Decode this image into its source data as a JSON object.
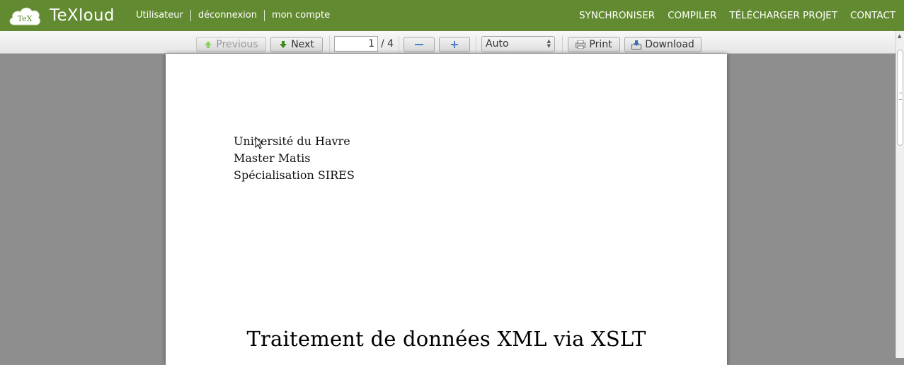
{
  "app": {
    "brand": "TeXloud",
    "logo_text": "TeX"
  },
  "nav": {
    "left": [
      "Utilisateur",
      "déconnexion",
      "mon compte"
    ],
    "right": [
      "SYNCHRONISER",
      "COMPILER",
      "TÉLÉCHARGER PROJET",
      "CONTACT"
    ]
  },
  "toolbar": {
    "previous_label": "Previous",
    "next_label": "Next",
    "page_value": "1",
    "page_total": "/ 4",
    "zoom_out_icon": "minus-icon",
    "zoom_in_icon": "plus-icon",
    "zoom_value": "Auto",
    "print_label": "Print",
    "download_label": "Download"
  },
  "document": {
    "header_lines": [
      "Université du Havre",
      "Master Matis",
      "Spécialisation SIRES"
    ],
    "title": "Traitement de données XML via XSLT"
  },
  "colors": {
    "topbar": "#628a30",
    "viewer_background": "#8e8e8e",
    "prev_arrow": "#8bd05a",
    "next_arrow": "#3c8a1e",
    "zoom_icons": "#4a7ec8"
  }
}
